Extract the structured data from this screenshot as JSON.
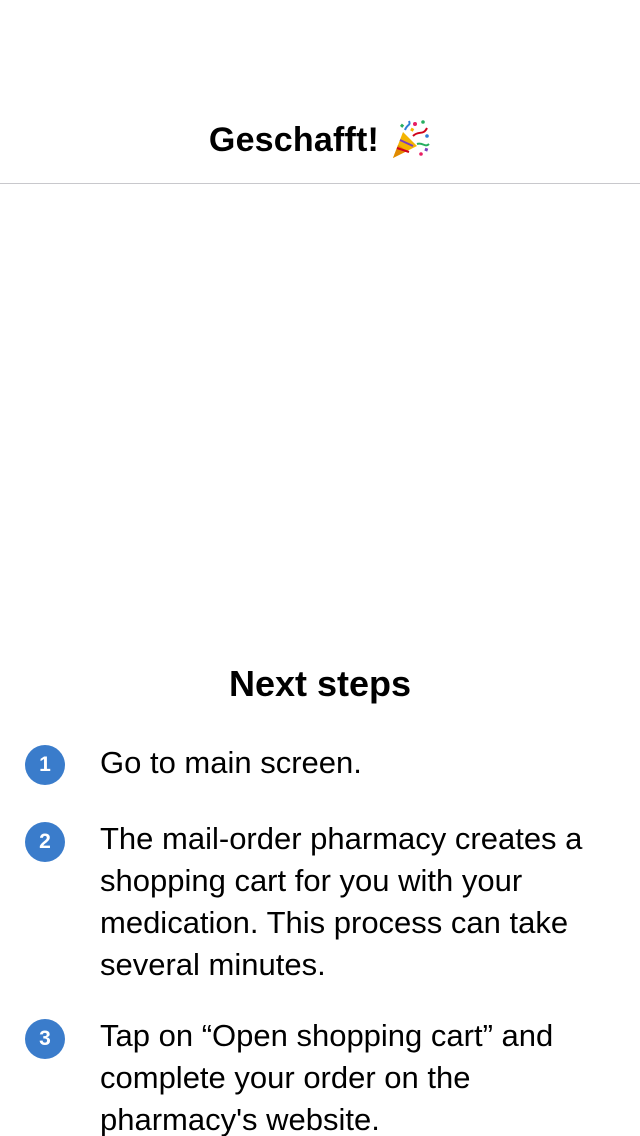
{
  "nav": {
    "title": "Geschafft!",
    "title_icon": "party-popper-icon"
  },
  "next_steps": {
    "title": "Next steps",
    "steps": [
      {
        "number": "1",
        "text": "Go to main screen."
      },
      {
        "number": "2",
        "text": "The mail-order pharmacy creates a shopping cart for you with your medication. This process can take several minutes."
      },
      {
        "number": "3",
        "text": "Tap on “Open shopping cart” and complete your order on the pharmacy's website."
      }
    ]
  },
  "colors": {
    "accent": "#3a7ccb",
    "divider": "#c8c8cc",
    "background": "#ffffff",
    "text": "#000000"
  }
}
